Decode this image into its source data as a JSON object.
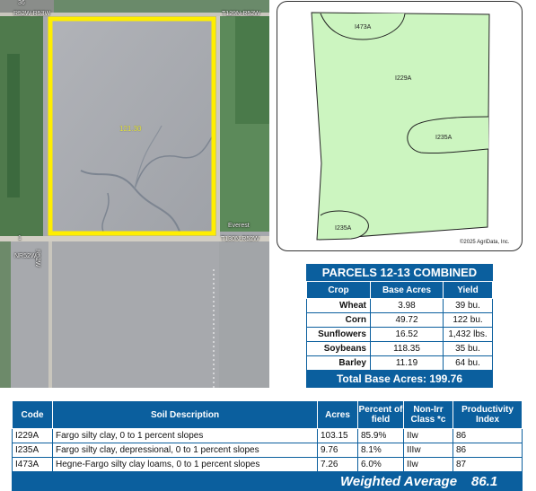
{
  "aerial": {
    "field_label": "121.30",
    "road_labels": {
      "top_left": "36",
      "top_left_road": "R52W-R53W",
      "top_right_road": "T129N-R52W",
      "everest": "Everest",
      "right_road": "T130N-R52W",
      "left_marker": "1",
      "left_road": "R52W",
      "left_road2": "NR52W"
    }
  },
  "soil_map": {
    "labels": {
      "i473a": "I473A",
      "i229a": "I229A",
      "i235a_right": "I235A",
      "i235a_left": "I235A"
    },
    "copyright": "©2025 AgriData, Inc."
  },
  "parcels": {
    "title": "PARCELS 12-13 COMBINED",
    "headers": [
      "Crop",
      "Base Acres",
      "Yield"
    ],
    "rows": [
      {
        "crop": "Wheat",
        "acres": "3.98",
        "yield": "39 bu."
      },
      {
        "crop": "Corn",
        "acres": "49.72",
        "yield": "122 bu."
      },
      {
        "crop": "Sunflowers",
        "acres": "16.52",
        "yield": "1,432 lbs."
      },
      {
        "crop": "Soybeans",
        "acres": "118.35",
        "yield": "35 bu."
      },
      {
        "crop": "Barley",
        "acres": "11.19",
        "yield": "64 bu."
      }
    ],
    "total": "Total Base Acres:  199.76"
  },
  "soil_table": {
    "headers": {
      "code": "Code",
      "desc": "Soil Description",
      "acres": "Acres",
      "pct": "Percent of field",
      "nonirr": "Non-Irr Class *c",
      "prod": "Productivity Index"
    },
    "rows": [
      {
        "code": "I229A",
        "desc": "Fargo silty clay, 0 to 1 percent slopes",
        "acres": "103.15",
        "pct": "85.9%",
        "class": "IIw",
        "prod": "86"
      },
      {
        "code": "I235A",
        "desc": "Fargo silty clay, depressional, 0 to 1 percent slopes",
        "acres": "9.76",
        "pct": "8.1%",
        "class": "IIIw",
        "prod": "86"
      },
      {
        "code": "I473A",
        "desc": "Hegne-Fargo silty clay loams, 0 to 1 percent slopes",
        "acres": "7.26",
        "pct": "6.0%",
        "class": "IIw",
        "prod": "87"
      }
    ],
    "weighted_label": "Weighted Average",
    "weighted_value": "86.1"
  },
  "colors": {
    "header_blue": "#0b5f9e",
    "field_border": "#ffee00",
    "soil_fill": "#ccf5c0"
  }
}
